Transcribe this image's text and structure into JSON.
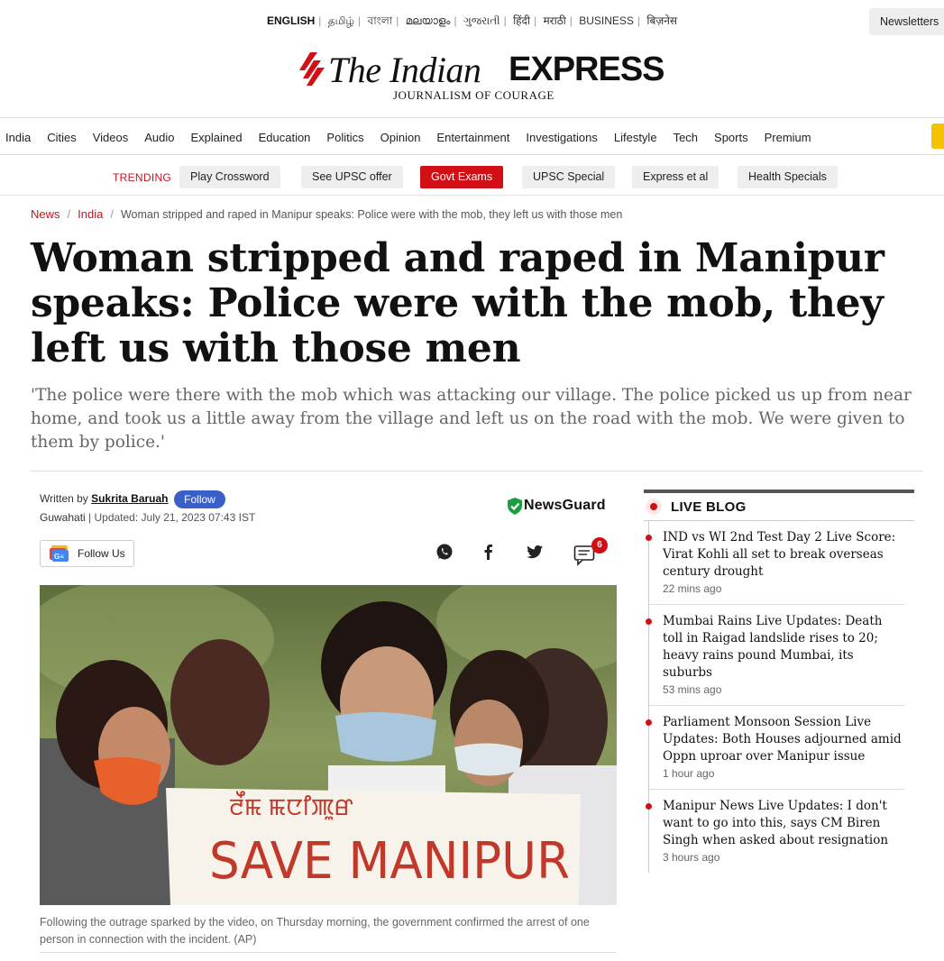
{
  "languages": [
    "ENGLISH",
    "தமிழ்",
    "বাংলা",
    "മലയാളം",
    "ગુજરાતી",
    "हिंदी",
    "मराठी",
    "BUSINESS",
    "बिज़नेस"
  ],
  "newsletters_label": "Newsletters",
  "logo": {
    "the_indian": "The Indian",
    "express": "EXPRESS",
    "tagline": "JOURNALISM OF COURAGE"
  },
  "nav": [
    "India",
    "Cities",
    "Videos",
    "Audio",
    "Explained",
    "Education",
    "Politics",
    "Opinion",
    "Entertainment",
    "Investigations",
    "Lifestyle",
    "Tech",
    "Sports",
    "Premium"
  ],
  "trending": {
    "label": "TRENDING",
    "chips": [
      "Play Crossword",
      "See UPSC offer",
      "Govt Exams",
      "UPSC Special",
      "Express et al",
      "Health Specials"
    ]
  },
  "breadcrumb": {
    "news": "News",
    "india": "India",
    "current": "Woman stripped and raped in Manipur speaks: Police were with the mob, they left us with those men"
  },
  "article": {
    "headline": "Woman stripped and raped in Manipur speaks: Police were with the mob, they left us with those men",
    "standfirst": "'The police were there with the mob which was attacking our village. The police picked us up from near home, and took us a little away from the village and left us on the road with the mob. We were given to them by police.'",
    "written_by": "Written by",
    "author": "Sukrita Baruah",
    "follow_label": "Follow",
    "city": "Guwahati",
    "updated": " | Updated: July 21, 2023 07:43 IST",
    "newsguard": "NewsGuard",
    "follow_us": "Follow Us",
    "comment_count": "6",
    "image_sign_top": "ꯂꯩꯃ ꯃꯅꯤꯄꯨꯔ",
    "image_sign": "SAVE MANIPUR",
    "caption": "Following the outrage sparked by the video, on Thursday morning, the government confirmed the arrest of one person in connection with the incident. (AP)"
  },
  "live_blog": {
    "title": "LIVE BLOG",
    "items": [
      {
        "headline": "IND vs WI 2nd Test Day 2 Live Score: Virat Kohli all set to break overseas century drought",
        "time": "22 mins ago"
      },
      {
        "headline": "Mumbai Rains Live Updates: Death toll in Raigad landslide rises to 20; heavy rains pound Mumbai, its suburbs",
        "time": "53 mins ago"
      },
      {
        "headline": "Parliament Monsoon Session Live Updates: Both Houses adjourned amid Oppn uproar over Manipur issue",
        "time": "1 hour ago"
      },
      {
        "headline": "Manipur News Live Updates: I don't want to go into this, says CM Biren Singh when asked about resignation",
        "time": "3 hours ago"
      }
    ]
  },
  "colors": {
    "brand_red": "#d30f16",
    "follow_blue": "#3a5fc6",
    "newsguard_green": "#1b9e3e"
  }
}
